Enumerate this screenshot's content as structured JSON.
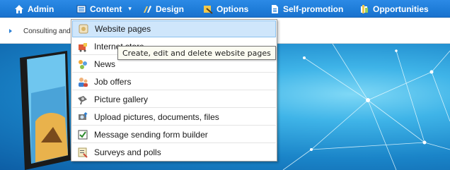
{
  "nav": {
    "items": [
      {
        "label": "Admin",
        "icon": "home-icon"
      },
      {
        "label": "Content",
        "icon": "content-list-icon"
      },
      {
        "label": "Design",
        "icon": "design-tools-icon"
      },
      {
        "label": "Options",
        "icon": "options-icon"
      },
      {
        "label": "Self-promotion",
        "icon": "document-icon"
      },
      {
        "label": "Opportunities",
        "icon": "opportunities-icon"
      }
    ],
    "caret": "▾"
  },
  "breadcrumb": {
    "text": "Consulting and"
  },
  "content_menu": {
    "items": [
      {
        "label": "Website pages",
        "icon": "website-pages-icon"
      },
      {
        "label": "Internet store",
        "icon": "store-icon"
      },
      {
        "label": "News",
        "icon": "news-icon"
      },
      {
        "label": "Job offers",
        "icon": "job-offers-icon"
      },
      {
        "label": "Picture gallery",
        "icon": "camera-icon"
      },
      {
        "label": "Upload pictures, documents, files",
        "icon": "upload-icon"
      },
      {
        "label": "Message sending form builder",
        "icon": "checkbox-icon"
      },
      {
        "label": "Surveys and polls",
        "icon": "survey-icon"
      }
    ]
  },
  "tooltip": {
    "text": "Create, edit and delete website pages"
  },
  "colors": {
    "nav_bg": "#1f7dd9",
    "menu_hover": "#cfe6fb",
    "tooltip_bg": "#fbfbf1"
  }
}
